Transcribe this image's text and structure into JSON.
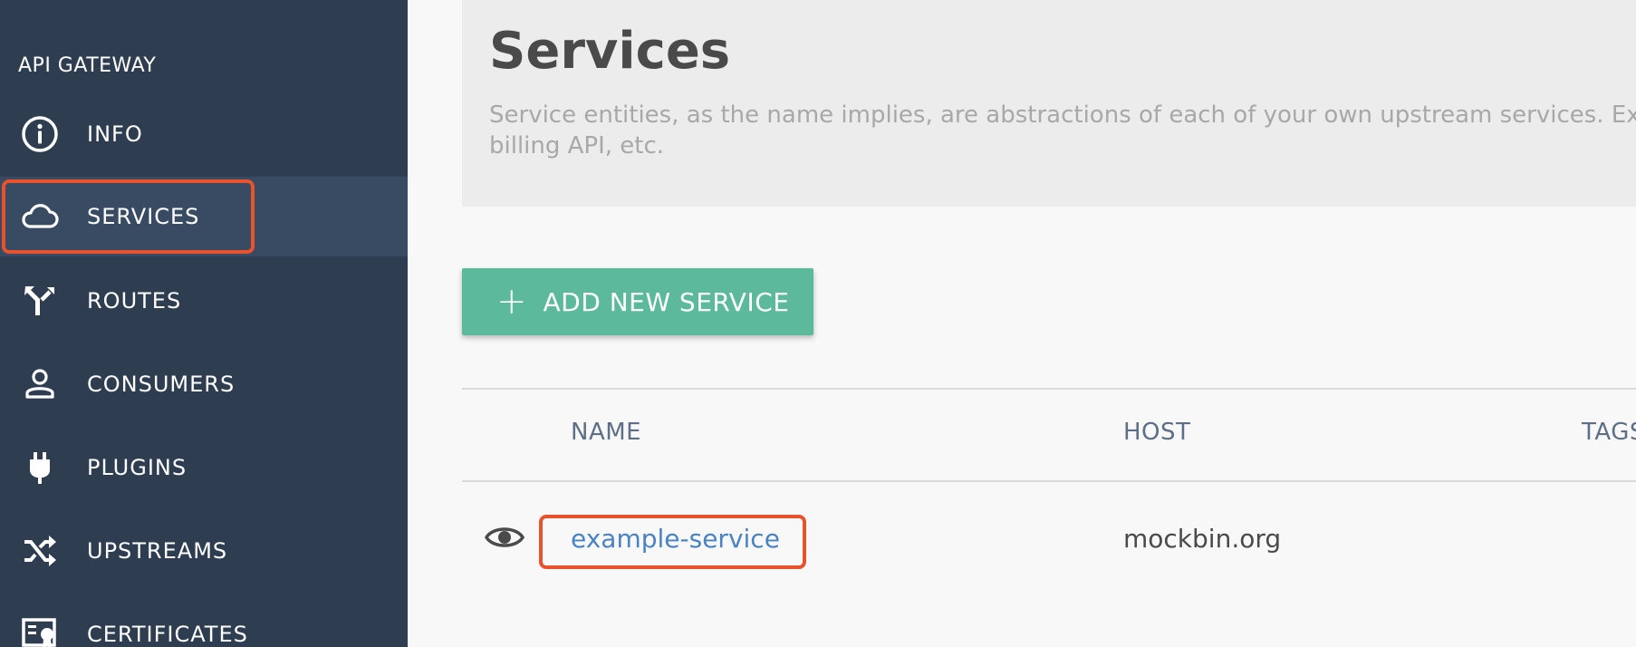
{
  "sidebar": {
    "heading": "API GATEWAY",
    "items": [
      {
        "label": "INFO",
        "icon": "info-icon"
      },
      {
        "label": "SERVICES",
        "icon": "cloud-icon",
        "active": true
      },
      {
        "label": "ROUTES",
        "icon": "routes-icon"
      },
      {
        "label": "CONSUMERS",
        "icon": "user-icon"
      },
      {
        "label": "PLUGINS",
        "icon": "plug-icon"
      },
      {
        "label": "UPSTREAMS",
        "icon": "shuffle-icon"
      },
      {
        "label": "CERTIFICATES",
        "icon": "certificate-icon"
      }
    ]
  },
  "main": {
    "title": "Services",
    "description_line1": "Service entities, as the name implies, are abstractions of each of your own upstream services. Examples of Services would be a data transformation microservice, a",
    "description_line2": "billing API, etc.",
    "add_button_label": "ADD NEW SERVICE",
    "table": {
      "headers": {
        "name": "NAME",
        "host": "HOST",
        "tags": "TAGS"
      },
      "rows": [
        {
          "name": "example-service",
          "host": "mockbin.org"
        }
      ]
    }
  },
  "colors": {
    "sidebar_bg": "#2e3e50",
    "sidebar_active_bg": "#394b62",
    "accent_green": "#5cb99c",
    "highlight_orange": "#e8522d",
    "link_blue": "#4a83c4"
  }
}
